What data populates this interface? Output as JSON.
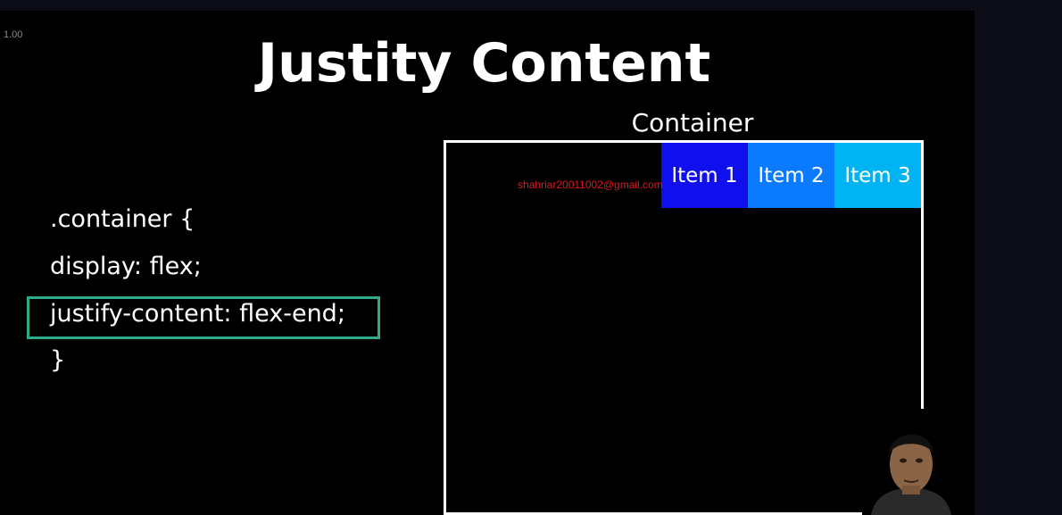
{
  "player": {
    "playback_speed": "1.00",
    "watermark": "shahriar20011002@gmail.com"
  },
  "slide": {
    "title": "Justity Content",
    "code_lines": [
      ".container {",
      "display: flex;",
      "justify-content: flex-end;",
      "}"
    ],
    "container_label": "Container",
    "items": [
      "Item 1",
      "Item 2",
      "Item 3"
    ]
  },
  "colors": {
    "background": "#000000",
    "item1": "#1010ee",
    "item2": "#0a7aff",
    "item3": "#00b4f4",
    "highlight_border": "#2eaa88",
    "watermark": "#e2191b"
  },
  "icons": {
    "presenter": "presenter-webcam-overlay"
  }
}
